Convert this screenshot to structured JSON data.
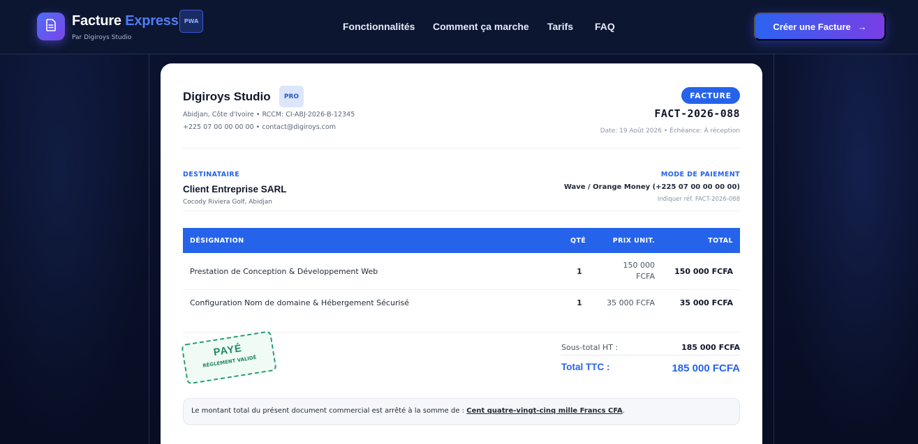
{
  "header": {
    "brand_primary": "Facture",
    "brand_accent": "Express",
    "brand_sub": "Par Digiroys Studio",
    "badge": "PWA",
    "logo_icon": "document-icon",
    "nav": [
      "Fonctionnalités",
      "Comment ça marche",
      "Tarifs",
      "FAQ"
    ],
    "cta_label": "Créer une Facture",
    "cta_icon": "arrow-right-icon"
  },
  "invoice": {
    "company_name": "Digiroys Studio",
    "company_badge": "PRO",
    "company_address": "Abidjan, Côte d'Ivoire • RCCM: CI-ABJ-2026-B-12345",
    "company_contact": "+225 07 00 00 00 00 • contact@digiroys.com",
    "doc_type": "FACTURE",
    "number": "FACT-2026-088",
    "dates": "Date: 19 Août 2026 • Échéance: À réception",
    "recipient_label": "DESTINATAIRE",
    "recipient_name": "Client Entreprise SARL",
    "recipient_address": "Cocody Riviera Golf, Abidjan",
    "payment_label": "MODE DE PAIEMENT",
    "payment_method": "Wave / Orange Money (+225 07 00 00 00 00)",
    "payment_ref": "Indiquer réf. FACT-2026-088",
    "table_headers": {
      "designation": "DÉSIGNATION",
      "qty": "QTÉ",
      "unit": "PRIX UNIT.",
      "total": "TOTAL"
    },
    "items": [
      {
        "designation": "Prestation de Conception & Développement Web",
        "qty": "1",
        "unit_line1": "150 000",
        "unit_line2": "FCFA",
        "total": "150 000 FCFA"
      },
      {
        "designation": "Configuration Nom de domaine & Hébergement Sécurisé",
        "qty": "1",
        "unit_line1": "35 000 FCFA",
        "unit_line2": "",
        "total": "35 000 FCFA"
      }
    ],
    "stamp_main": "PAYÉ",
    "stamp_sub": "RÈGLEMENT VALIDÉ",
    "subtotal_label": "Sous-total HT :",
    "subtotal_value": "185 000 FCFA",
    "total_label": "Total TTC :",
    "total_value": "185 000 FCFA",
    "note_prefix": "Le montant total du présent document commercial est arrêté à la somme de :",
    "note_amount_words": "Cent quatre-vingt-cinq mille Francs CFA",
    "note_suffix": "."
  },
  "colors": {
    "accent": "#2563eb",
    "header_bg": "#0d1631",
    "stamp_green": "#1a8a5d"
  }
}
